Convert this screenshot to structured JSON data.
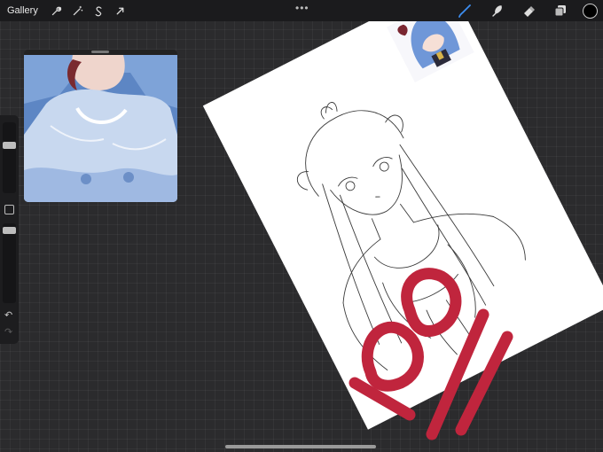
{
  "toolbar": {
    "gallery_label": "Gallery",
    "left_icons": [
      "wrench-icon",
      "magic-wand-icon",
      "selection-s-icon",
      "transform-arrow-icon"
    ],
    "more_label": "•••",
    "right_icons": [
      "brush-icon",
      "smudge-icon",
      "eraser-icon",
      "layers-icon"
    ],
    "active_color": "#000000",
    "brush_active_color": "#3d8ef0"
  },
  "sidebar": {
    "size_slider_value": 0.3,
    "opacity_slider_value": 0.05,
    "undo_glyph": "↶",
    "redo_glyph": "↷"
  },
  "reference": {
    "description_icon": "photo-thumbnail"
  },
  "canvas": {
    "overlay_text": "100%",
    "overlay_color": "#c0253d"
  }
}
